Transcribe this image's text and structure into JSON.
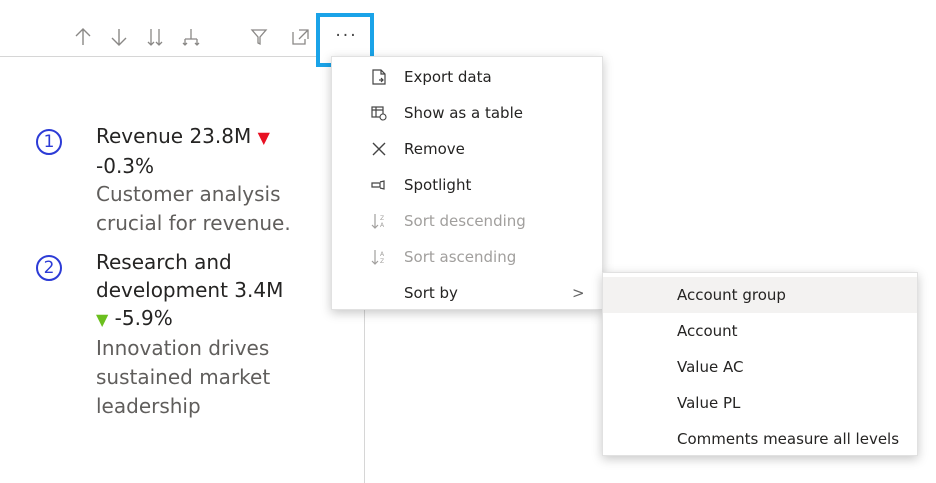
{
  "toolbar": {
    "buttons": [
      {
        "name": "drill-up-icon"
      },
      {
        "name": "drill-down-icon"
      },
      {
        "name": "expand-next-level-icon"
      },
      {
        "name": "expand-hierarchy-icon"
      },
      {
        "name": "filter-icon"
      },
      {
        "name": "focus-mode-icon"
      }
    ],
    "more_label": "···"
  },
  "comments": [
    {
      "number": "1",
      "title": "Revenue 23.8M ",
      "arrow": "▼",
      "direction": "down",
      "delta": "-0.3%",
      "description": "Customer analysis crucial for revenue."
    },
    {
      "number": "2",
      "title": "Research and development 3.4M ",
      "arrow": "▼",
      "direction": "up",
      "delta": "-5.9%",
      "description": "Innovation drives sustained market leadership"
    }
  ],
  "colors": {
    "accent_border": "#1aa3e8",
    "number_circle": "#2c3bd6",
    "down_arrow": "#e81123",
    "up_arrow": "#6bbf1e"
  },
  "menu": {
    "items": [
      {
        "label": "Export data",
        "icon": "export-icon",
        "enabled": true
      },
      {
        "label": "Show as a table",
        "icon": "table-icon",
        "enabled": true
      },
      {
        "label": "Remove",
        "icon": "close-icon",
        "enabled": true
      },
      {
        "label": "Spotlight",
        "icon": "spotlight-icon",
        "enabled": true
      },
      {
        "label": "Sort descending",
        "icon": "sort-descending-icon",
        "enabled": false
      },
      {
        "label": "Sort ascending",
        "icon": "sort-ascending-icon",
        "enabled": false
      },
      {
        "label": "Sort by",
        "icon": "",
        "enabled": true,
        "submenu_chevron": ">"
      }
    ]
  },
  "submenu": {
    "items": [
      {
        "label": "Account group",
        "hovered": true
      },
      {
        "label": "Account",
        "hovered": false
      },
      {
        "label": "Value AC",
        "hovered": false
      },
      {
        "label": "Value PL",
        "hovered": false
      },
      {
        "label": "Comments measure all levels",
        "hovered": false
      }
    ]
  }
}
